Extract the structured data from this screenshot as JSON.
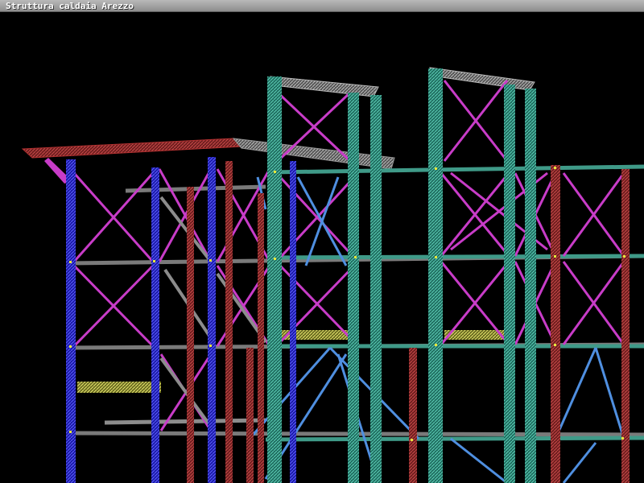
{
  "window": {
    "title": "Struttura caldaia Arezzo"
  },
  "viewport": {
    "background": "#000000",
    "render_mode": "wireframe 3D steel structure",
    "colors": {
      "column_blue": "#2a2ae0",
      "column_red": "#9a2b2b",
      "column_teal": "#2e8f7c",
      "brace_magenta": "#c83cc8",
      "brace_lightblue": "#4f8fe0",
      "beam_grey": "#8c8c8c",
      "roof_red": "#b03030",
      "node_yellow": "#e6e63c"
    }
  }
}
